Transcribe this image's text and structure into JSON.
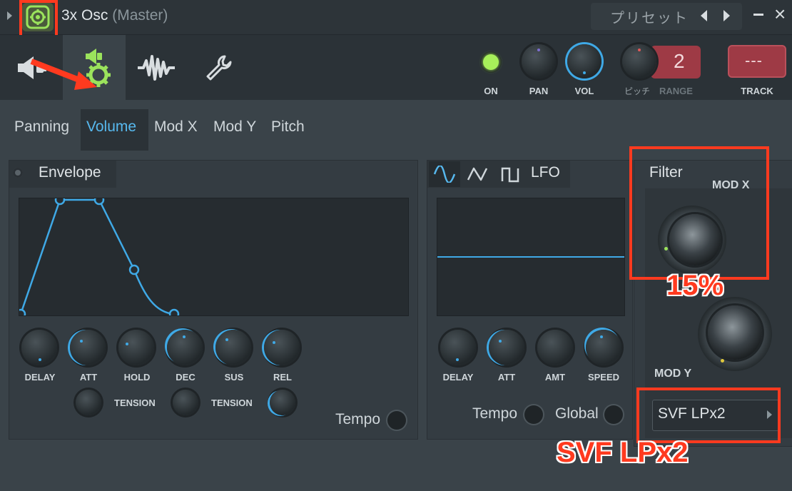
{
  "window": {
    "title": "3x Osc",
    "subtitle": "(Master)",
    "preset_label": "プリセット"
  },
  "toolbar": {
    "tabs": [
      {
        "name": "plugin-tab",
        "icon": "speaker-plug-icon"
      },
      {
        "name": "channel-settings-tab",
        "icon": "speaker-gear-icon"
      },
      {
        "name": "misc-tab",
        "icon": "waveform-icon"
      },
      {
        "name": "settings-tab",
        "icon": "wrench-icon"
      }
    ],
    "on_label": "ON",
    "pan_label": "PAN",
    "vol_label": "VOL",
    "pitch_label": "ピッチ",
    "range_label": "RANGE",
    "range_value": "2",
    "track_label": "TRACK",
    "track_value": "---"
  },
  "subtabs": [
    "Panning",
    "Volume",
    "Mod X",
    "Mod Y",
    "Pitch"
  ],
  "active_subtab": "Volume",
  "envelope": {
    "title": "Envelope",
    "knobs": [
      "DELAY",
      "ATT",
      "HOLD",
      "DEC",
      "SUS",
      "REL"
    ],
    "tension_label": "TENSION",
    "tension2_label": "TENSION",
    "tempo_label": "Tempo"
  },
  "lfo": {
    "title": "LFO",
    "knobs": [
      "DELAY",
      "ATT",
      "AMT",
      "SPEED"
    ],
    "tempo_label": "Tempo",
    "global_label": "Global"
  },
  "filter": {
    "title": "Filter",
    "mod_x_label": "MOD X",
    "mod_y_label": "MOD Y",
    "type_value": "SVF LPx2"
  },
  "annotations": {
    "percent": "15%",
    "filter_type": "SVF LPx2"
  },
  "colors": {
    "accent_blue": "#3fa9e6",
    "accent_green": "#9be35c",
    "annotation_red": "#ff3a1f",
    "track_red": "#9e3a45"
  }
}
